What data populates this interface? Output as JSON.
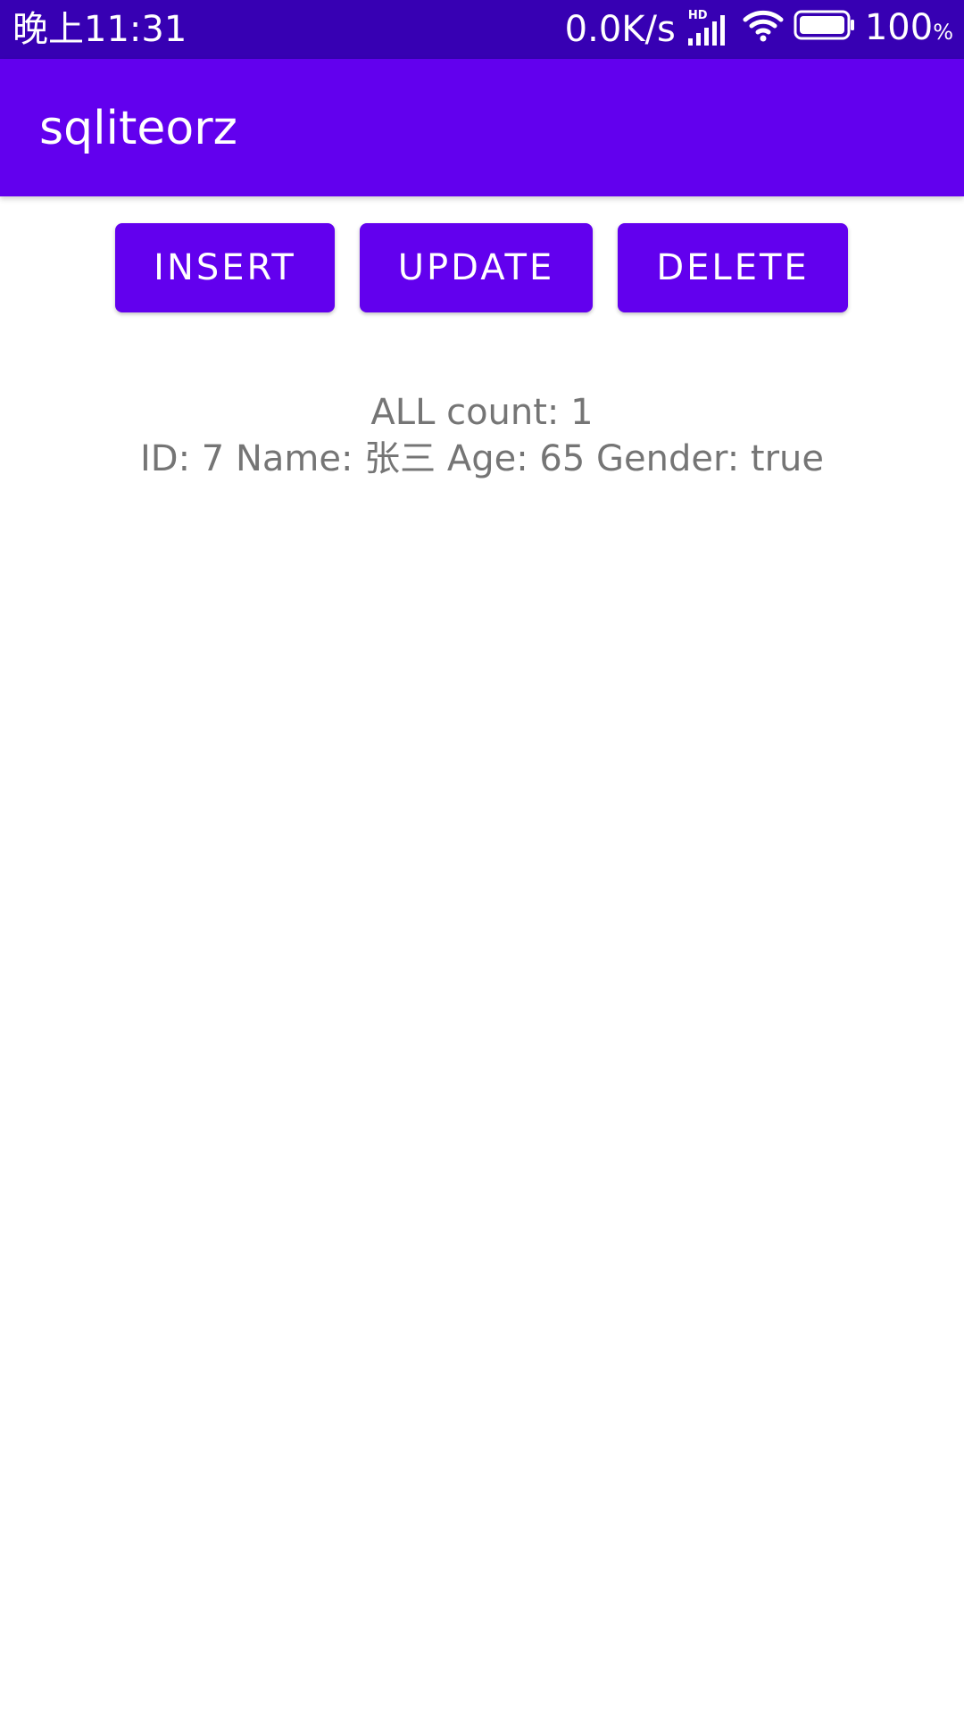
{
  "status_bar": {
    "time": "晚上11:31",
    "net_speed": "0.0K/s",
    "network_badge": "HD",
    "battery_percent": "100",
    "battery_percent_sign": "%",
    "icons": [
      "signal-icon",
      "wifi-icon",
      "battery-icon"
    ],
    "background_color": "#3700b3"
  },
  "app_bar": {
    "title": "sqliteorz",
    "background_color": "#6200ee"
  },
  "buttons": {
    "insert_label": "INSERT",
    "update_label": "UPDATE",
    "delete_label": "DELETE",
    "color": "#6200ee"
  },
  "results": {
    "count_line": "ALL count: 1",
    "record_line": "ID: 7 Name: 张三 Age: 65 Gender: true",
    "text_color": "#757575"
  }
}
